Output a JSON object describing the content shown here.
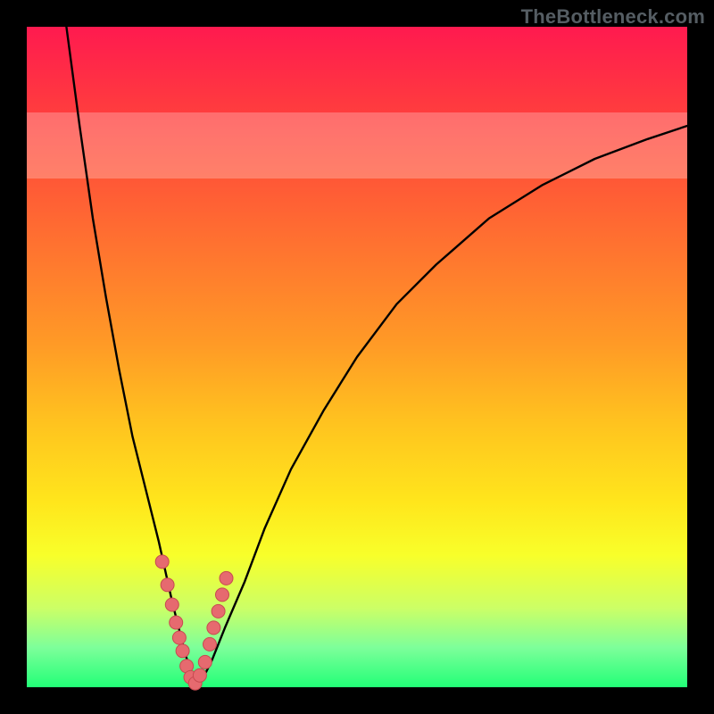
{
  "watermark": "TheBottleneck.com",
  "colors": {
    "frame": "#000000",
    "curve_stroke": "#000000",
    "marker_fill": "#e66a6f",
    "marker_stroke": "#c74a50"
  },
  "chart_data": {
    "type": "line",
    "title": "",
    "xlabel": "",
    "ylabel": "",
    "xlim": [
      0,
      100
    ],
    "ylim": [
      0,
      100
    ],
    "grid": false,
    "legend": false,
    "series": [
      {
        "name": "bottleneck-curve",
        "x": [
          6,
          8,
          10,
          12,
          14,
          16,
          18,
          20,
          22,
          23,
          24,
          25,
          26,
          28,
          30,
          33,
          36,
          40,
          45,
          50,
          56,
          62,
          70,
          78,
          86,
          94,
          100
        ],
        "y": [
          100,
          85,
          71,
          59,
          48,
          38,
          30,
          22,
          13,
          9,
          5,
          2,
          0,
          4,
          9,
          16,
          24,
          33,
          42,
          50,
          58,
          64,
          71,
          76,
          80,
          83,
          85
        ]
      }
    ],
    "markers": {
      "name": "highlighted-points",
      "x": [
        20.5,
        21.3,
        22.0,
        22.6,
        23.1,
        23.6,
        24.2,
        24.8,
        25.5,
        26.2,
        27.0,
        27.7,
        28.3,
        29.0,
        29.6,
        30.2
      ],
      "y": [
        19.0,
        15.5,
        12.5,
        9.8,
        7.5,
        5.5,
        3.2,
        1.5,
        0.6,
        1.8,
        3.8,
        6.5,
        9.0,
        11.5,
        14.0,
        16.5
      ]
    },
    "pale_band": {
      "y0": 77,
      "y1": 87
    }
  }
}
